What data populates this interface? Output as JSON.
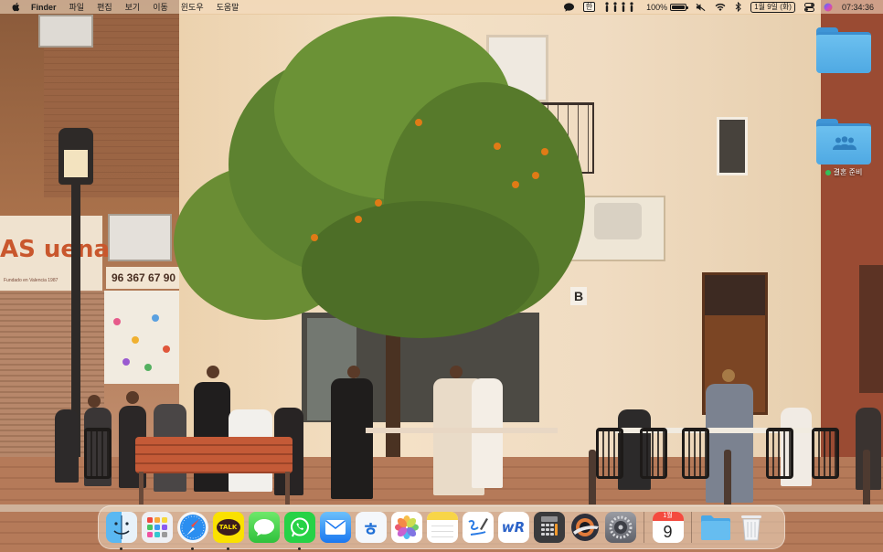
{
  "menubar": {
    "app_name": "Finder",
    "menus": [
      "파일",
      "편집",
      "보기",
      "이동",
      "윈도우",
      "도움말"
    ],
    "status": {
      "ime_label": "한",
      "battery_percent": "100%",
      "battery_level": 1.0,
      "date": "1월 9일 (화)",
      "time": "07:34:36"
    }
  },
  "desktop": {
    "folders": [
      {
        "label": "",
        "icon": "folder-icon",
        "color": "#4fa9e3"
      },
      {
        "label": "결혼 준비",
        "icon": "shared-folder-icon",
        "color": "#4fa9e3",
        "tag_color": "#32c25a"
      }
    ]
  },
  "wallpaper": {
    "sign_text": "AS uena",
    "sign_subtext": "Fundado en Valencia 1987",
    "phone_text": "96 367 67 90",
    "building_letter": "B"
  },
  "dock": {
    "apps": [
      {
        "name": "Finder",
        "icon": "finder-icon",
        "running": true
      },
      {
        "name": "Launchpad",
        "icon": "launchpad-icon",
        "running": false
      },
      {
        "name": "Safari",
        "icon": "safari-icon",
        "running": true
      },
      {
        "name": "KakaoTalk",
        "icon": "kakaotalk-icon",
        "running": true,
        "text": "TALK"
      },
      {
        "name": "Messages",
        "icon": "messages-icon",
        "running": false
      },
      {
        "name": "WhatsApp",
        "icon": "whatsapp-icon",
        "running": true
      },
      {
        "name": "Mail",
        "icon": "mail-icon",
        "running": false
      },
      {
        "name": "Hancom",
        "icon": "hancom-icon",
        "running": false,
        "text": "ㅎ"
      },
      {
        "name": "Photos",
        "icon": "photos-icon",
        "running": false
      },
      {
        "name": "Notes",
        "icon": "notes-icon",
        "running": false
      },
      {
        "name": "Freeform",
        "icon": "freeform-icon",
        "running": false
      },
      {
        "name": "WR",
        "icon": "wr-icon",
        "running": false,
        "text": "wR"
      },
      {
        "name": "Calculator",
        "icon": "calculator-icon",
        "running": false
      },
      {
        "name": "Image Capture",
        "icon": "image-capture-icon",
        "running": false
      },
      {
        "name": "System Settings",
        "icon": "settings-icon",
        "running": false
      }
    ],
    "calendar": {
      "month": "1월",
      "day": "9",
      "icon": "calendar-icon"
    },
    "downloads": {
      "icon": "downloads-folder-icon"
    },
    "trash": {
      "icon": "trash-icon"
    }
  },
  "colors": {
    "menubar_bg": "#fae6cd",
    "folder_blue": "#4fa9e3",
    "tag_green": "#32c25a"
  }
}
